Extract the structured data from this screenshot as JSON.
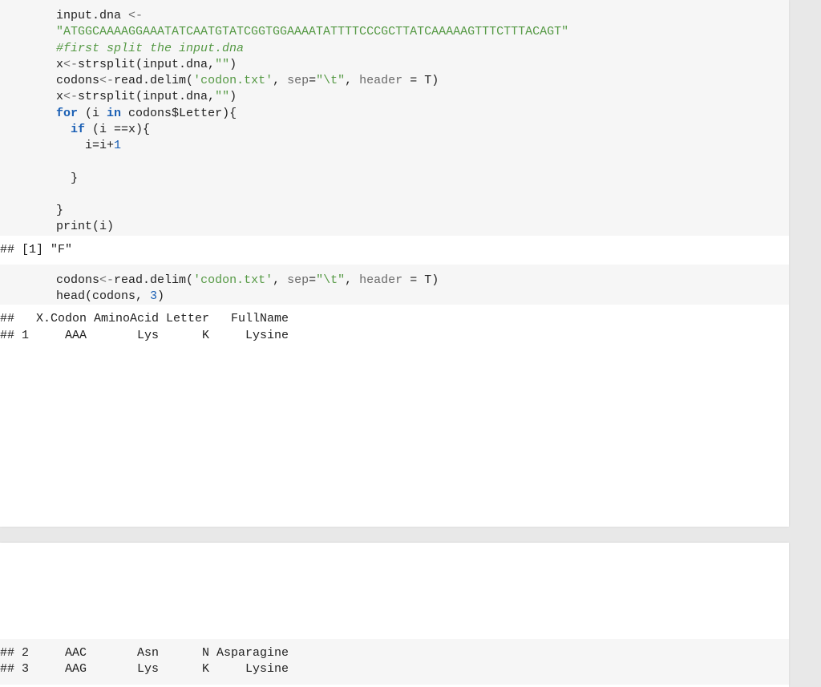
{
  "block1": {
    "l1a": "input.dna ",
    "l1b": "<-",
    "l2": "\"ATGGCAAAAGGAAATATCAATGTATCGGTGGAAAATATTTTCCCGCTTATCAAAAAGTTTCTTTACAGT\"",
    "l3": "#first split the input.dna",
    "l4a": "x",
    "l4b": "<-",
    "l4c": "strsplit(input.dna,",
    "l4d": "\"\"",
    "l4e": ")",
    "l5a": "codons",
    "l5b": "<-",
    "l5c": "read.delim(",
    "l5d": "'codon.txt'",
    "l5e": ", ",
    "l5f": "sep",
    "l5g": "=",
    "l5h": "\"\\t\"",
    "l5i": ", ",
    "l5j": "header",
    "l5k": " = T)",
    "l6a": "x",
    "l6b": "<-",
    "l6c": "strsplit(input.dna,",
    "l6d": "\"\"",
    "l6e": ")",
    "l7a": "for",
    "l7b": " (i ",
    "l7c": "in",
    "l7d": " codons$Letter){",
    "l8a": "  ",
    "l8b": "if",
    "l8c": " (i ==x){",
    "l9a": "    i=i+",
    "l9b": "1",
    "l10": "    ",
    "l11": "  }",
    "l12": "  ",
    "l13": "}",
    "l14": "print(i)"
  },
  "out1": {
    "l1": "## [1] \"F\""
  },
  "block2": {
    "l1a": "codons",
    "l1b": "<-",
    "l1c": "read.delim(",
    "l1d": "'codon.txt'",
    "l1e": ", ",
    "l1f": "sep",
    "l1g": "=",
    "l1h": "\"\\t\"",
    "l1i": ", ",
    "l1j": "header",
    "l1k": " = T)",
    "l2a": "head(codons, ",
    "l2b": "3",
    "l2c": ")"
  },
  "out2": {
    "l1": "##   X.Codon AminoAcid Letter   FullName",
    "l2": "## 1     AAA       Lys      K     Lysine"
  },
  "out3": {
    "l1": "## 2     AAC       Asn      N Asparagine",
    "l2": "## 3     AAG       Lys      K     Lysine"
  }
}
